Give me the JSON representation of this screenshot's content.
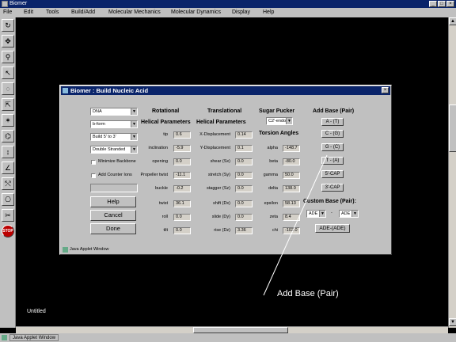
{
  "app": {
    "title": "Biomer",
    "menu": [
      "File",
      "Edit",
      "Tools",
      "Build/Add",
      "Molecular Mechanics",
      "Molecular Dynamics",
      "Display",
      "Help"
    ],
    "canvas_label": "Untitled",
    "status_label": "Java Applet Window",
    "stop_label": "STOP"
  },
  "dialog": {
    "title": "Biomer : Build Nucleic Acid",
    "status_label": "Java Applet Window",
    "selects": [
      "DNA",
      "b-form",
      "Build 5' to 3'",
      "Double Stranded"
    ],
    "checkboxes": [
      "Minimize Backbone",
      "Add Counter Ions"
    ],
    "buttons": {
      "help": "Help",
      "cancel": "Cancel",
      "done": "Done"
    },
    "headers": {
      "rotational": "Rotational",
      "helical_params_1": "Helical Parameters",
      "translational": "Translational",
      "helical_params_2": "Helical Parameters",
      "sugar_pucker": "Sugar Pucker",
      "torsion_angles": "Torsion Angles",
      "add_base_pair": "Add Base (Pair)",
      "custom_base_pair": "Custom Base (Pair):"
    },
    "sugar_pucker_value": "C2'-endo",
    "rotational_params": [
      {
        "label": "tip",
        "value": "0.6"
      },
      {
        "label": "inclination",
        "value": "-5.9"
      },
      {
        "label": "opening",
        "value": "0.0"
      },
      {
        "label": "Propeller twist",
        "value": "-11.1"
      },
      {
        "label": "buckle",
        "value": "-0.2"
      },
      {
        "label": "twist",
        "value": "36.1"
      },
      {
        "label": "roll",
        "value": "0.0"
      },
      {
        "label": "tilt",
        "value": "0.0"
      }
    ],
    "translational_params": [
      {
        "label": "X-Displacement",
        "value": "0.14"
      },
      {
        "label": "Y-Displacement",
        "value": "0.1"
      },
      {
        "label": "shear (Sx)",
        "value": "0.0"
      },
      {
        "label": "stretch (Sy)",
        "value": "0.0"
      },
      {
        "label": "stagger (Sz)",
        "value": "0.0"
      },
      {
        "label": "shift (Dx)",
        "value": "0.0"
      },
      {
        "label": "slide (Dy)",
        "value": "0.0"
      },
      {
        "label": "rise (Dz)",
        "value": "3.36"
      }
    ],
    "torsion_params": [
      {
        "label": "alpha",
        "value": "-148.7"
      },
      {
        "label": "beta",
        "value": "-80.0"
      },
      {
        "label": "gamma",
        "value": "50.0"
      },
      {
        "label": "delta",
        "value": "138.0"
      },
      {
        "label": "epsilon",
        "value": "58.13"
      },
      {
        "label": "zeta",
        "value": "8.4"
      },
      {
        "label": "chi",
        "value": "-102.0"
      }
    ],
    "base_buttons": [
      "A - (T)",
      "C - (G)",
      "G - (C)",
      "T - (A)",
      "5'-CAP",
      "3'-CAP"
    ],
    "custom_base": {
      "left": "ADE",
      "separator": "-",
      "right": "ADE",
      "button": "ADE-(ADE)"
    }
  },
  "annotation": {
    "text": "Add Base (Pair)"
  }
}
